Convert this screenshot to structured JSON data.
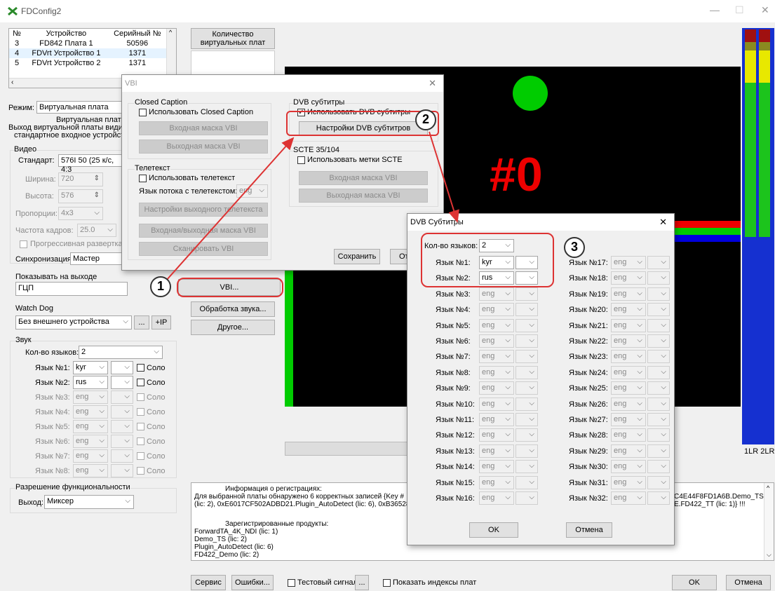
{
  "window": {
    "title": "FDConfig2"
  },
  "devices": {
    "headers": [
      "№",
      "Устройство",
      "Серийный №"
    ],
    "rows": [
      [
        "3",
        "FD842 Плата 1",
        "50596"
      ],
      [
        "4",
        "FDVrt Устройство 1",
        "1371"
      ],
      [
        "5",
        "FDVrt Устройство 2",
        "1371"
      ]
    ]
  },
  "mode": {
    "label": "Режим:",
    "value": "Виртуальная плата",
    "desc1": "Виртуальная плата",
    "desc2": "Выход виртуальной платы видит",
    "desc3": "стандартное входное устройст"
  },
  "video": {
    "group": "Видео",
    "standard_label": "Стандарт:",
    "standard_value": "576I 50 (25 к/с, 4:3",
    "width_label": "Ширина:",
    "width_value": "720",
    "height_label": "Высота:",
    "height_value": "576",
    "aspect_label": "Пропорции:",
    "aspect_value": "4x3",
    "fps_label": "Частота кадров:",
    "fps_value": "25.0",
    "progressive": "Прогрессивная развертка",
    "sync_label": "Синхронизация:",
    "sync_value": "Мастер"
  },
  "output": {
    "group": "Показывать на выходе",
    "value": "ГЦП"
  },
  "watchdog": {
    "group": "Watch Dog",
    "value": "Без внешнего устройства",
    "dots": "...",
    "ip": "+IP"
  },
  "sound": {
    "group": "Звук",
    "count_label": "Кол-во языков:",
    "count_value": "2",
    "langs": [
      {
        "label": "Язык №1:",
        "value": "kyr",
        "solo": "Соло"
      },
      {
        "label": "Язык №2:",
        "value": "rus",
        "solo": "Соло"
      },
      {
        "label": "Язык №3:",
        "value": "eng",
        "solo": "Соло"
      },
      {
        "label": "Язык №4:",
        "value": "eng",
        "solo": "Соло"
      },
      {
        "label": "Язык №5:",
        "value": "eng",
        "solo": "Соло"
      },
      {
        "label": "Язык №6:",
        "value": "eng",
        "solo": "Соло"
      },
      {
        "label": "Язык №7:",
        "value": "eng",
        "solo": "Соло"
      },
      {
        "label": "Язык №8:",
        "value": "eng",
        "solo": "Соло"
      }
    ]
  },
  "functionality": {
    "group": "Разрешение функциональности",
    "output_label": "Выход:",
    "output_value": "Миксер"
  },
  "midbuttons": {
    "virtual_count": "Количество виртуальных плат",
    "vbi": "VBI...",
    "sound": "Обработка звука...",
    "other": "Другое..."
  },
  "preview": {
    "big": "#0"
  },
  "meters": {
    "labels": "1LR 2LR"
  },
  "info": {
    "title": "Информация о регистрациях:",
    "l1": "Для выбранной платы обнаружено 6 корректных записей {Key #",
    "l2": "(lic: 2), 0xE6017CF502ADBD21.Plugin_AutoDetect (lic: 6), 0xB36528B",
    "r1": "C4E44F8FD1A6B.Demo_TS",
    "r2": "E.FD422_TT (lic: 1)} !!!",
    "products_title": "Зарегистрированные продукты:",
    "products": [
      "ForwardTA_4K_NDI (lic: 1)",
      "Demo_TS (lic: 2)",
      "Plugin_AutoDetect (lic: 6)",
      "FD422_Demo (lic: 2)"
    ]
  },
  "bottom": {
    "service": "Сервис",
    "errors": "Ошибки...",
    "test_signal": "Тестовый сигнал",
    "dots": "...",
    "show_indexes": "Показать индексы плат",
    "ok": "OK",
    "cancel": "Отмена"
  },
  "vbi": {
    "title": "VBI",
    "cc_group": "Closed Caption",
    "cc_use": "Использовать Closed Caption",
    "cc_in": "Входная маска VBI",
    "cc_out": "Выходная маска VBI",
    "tt_group": "Телетекст",
    "tt_use": "Использовать телетекст",
    "tt_lang_label": "Язык потока с телетекстом:",
    "tt_lang": "eng",
    "tt_settings": "Настройки выходного телетекста",
    "tt_mask": "Входная/выходная маска VBI",
    "tt_scan": "Сканировать VBI",
    "dvb_group": "DVB субтитры",
    "dvb_use": "Использовать DVB субтитры",
    "dvb_settings": "Настройки DVB субтитров",
    "scte_group": "SCTE 35/104",
    "scte_use": "Использовать метки SCTE",
    "scte_in": "Входная маска VBI",
    "scte_out": "Выходная маска VBI",
    "save": "Сохранить",
    "cancel_partial": "От"
  },
  "dvbsub": {
    "title": "DVB Субтитры",
    "count_label": "Кол-во языков:",
    "count_value": "2",
    "left": [
      {
        "label": "Язык №1:",
        "value": "kyr"
      },
      {
        "label": "Язык №2:",
        "value": "rus"
      },
      {
        "label": "Язык №3:",
        "value": "eng"
      },
      {
        "label": "Язык №4:",
        "value": "eng"
      },
      {
        "label": "Язык №5:",
        "value": "eng"
      },
      {
        "label": "Язык №6:",
        "value": "eng"
      },
      {
        "label": "Язык №7:",
        "value": "eng"
      },
      {
        "label": "Язык №8:",
        "value": "eng"
      },
      {
        "label": "Язык №9:",
        "value": "eng"
      },
      {
        "label": "Язык №10:",
        "value": "eng"
      },
      {
        "label": "Язык №11:",
        "value": "eng"
      },
      {
        "label": "Язык №12:",
        "value": "eng"
      },
      {
        "label": "Язык №13:",
        "value": "eng"
      },
      {
        "label": "Язык №14:",
        "value": "eng"
      },
      {
        "label": "Язык №15:",
        "value": "eng"
      },
      {
        "label": "Язык №16:",
        "value": "eng"
      }
    ],
    "right": [
      {
        "label": "Язык №17:",
        "value": "eng"
      },
      {
        "label": "Язык №18:",
        "value": "eng"
      },
      {
        "label": "Язык №19:",
        "value": "eng"
      },
      {
        "label": "Язык №20:",
        "value": "eng"
      },
      {
        "label": "Язык №21:",
        "value": "eng"
      },
      {
        "label": "Язык №22:",
        "value": "eng"
      },
      {
        "label": "Язык №23:",
        "value": "eng"
      },
      {
        "label": "Язык №24:",
        "value": "eng"
      },
      {
        "label": "Язык №25:",
        "value": "eng"
      },
      {
        "label": "Язык №26:",
        "value": "eng"
      },
      {
        "label": "Язык №27:",
        "value": "eng"
      },
      {
        "label": "Язык №28:",
        "value": "eng"
      },
      {
        "label": "Язык №29:",
        "value": "eng"
      },
      {
        "label": "Язык №30:",
        "value": "eng"
      },
      {
        "label": "Язык №31:",
        "value": "eng"
      },
      {
        "label": "Язык №32:",
        "value": "eng"
      }
    ],
    "ok": "OK",
    "cancel": "Отмена"
  },
  "annotations": {
    "n1": "1",
    "n2": "2",
    "n3": "3"
  }
}
